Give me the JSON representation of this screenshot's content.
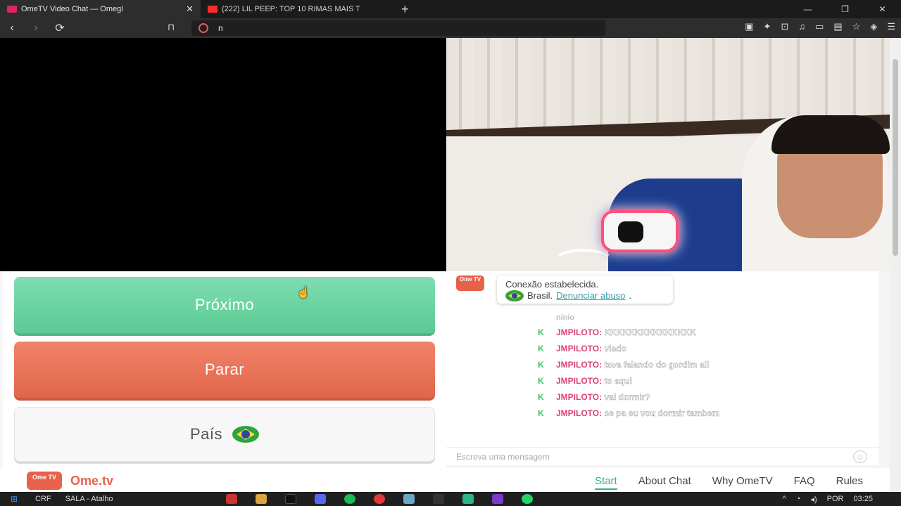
{
  "browser": {
    "tabs": [
      {
        "title": "OmeTV Video Chat — Omegl",
        "close": "✕"
      },
      {
        "title": "(222) LIL PEEP: TOP 10 RIMAS MAIS T"
      }
    ],
    "new_tab": "+",
    "window_controls": [
      "—",
      "❐",
      "✕"
    ],
    "address": "n"
  },
  "controls": {
    "next_label": "Próximo",
    "stop_label": "Parar",
    "country_label": "País"
  },
  "chat": {
    "logo_text": "Ome TV",
    "connection": "Conexão estabelecida.",
    "country": "Brasil.",
    "report_link": "Denunciar abuso",
    "faded_top": "ninio",
    "messages": [
      {
        "name": "JMPILOTO:",
        "text": "KKKKKKKKKKKKKKK"
      },
      {
        "name": "JMPILOTO:",
        "text": "viado"
      },
      {
        "name": "JMPILOTO:",
        "text": "tava falando do gordim ali"
      },
      {
        "name": "JMPILOTO:",
        "text": "to aqui"
      },
      {
        "name": "JMPILOTO:",
        "text": "vai dormir?"
      },
      {
        "name": "JMPILOTO:",
        "text": "se pa eu vou dormir tambem"
      }
    ],
    "input_placeholder": "Escreva uma mensagem"
  },
  "footer": {
    "logo_text": "Ome TV",
    "brand": "Ome.tv",
    "links": [
      "Start",
      "About Chat",
      "Why OmeTV",
      "FAQ",
      "Rules"
    ]
  },
  "taskbar": {
    "items": [
      "CRF",
      "SALA - Atalho"
    ],
    "lang": "POR",
    "time": "03:25"
  }
}
